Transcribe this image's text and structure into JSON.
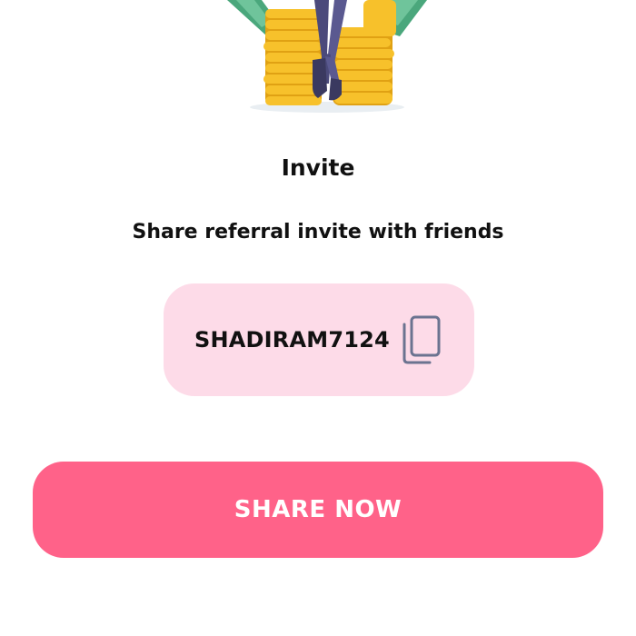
{
  "illustration": {
    "icon": "coins-stack-with-person-illustration",
    "colors": {
      "coin": "#f7c12b",
      "coin_shadow": "#e0a113",
      "pants": "#4b4a7b",
      "shoes": "#3a3960",
      "banknote": "#4aa77c"
    }
  },
  "invite": {
    "title": "Invite",
    "subtitle": "Share referral invite with friends"
  },
  "referral": {
    "code": "SHADIRAM7124",
    "copy_icon": "copy-icon"
  },
  "share_button": {
    "label": "SHARE NOW"
  },
  "colors": {
    "accent": "#ff6289",
    "code_box_bg": "#fddbe8",
    "text": "#111111"
  }
}
